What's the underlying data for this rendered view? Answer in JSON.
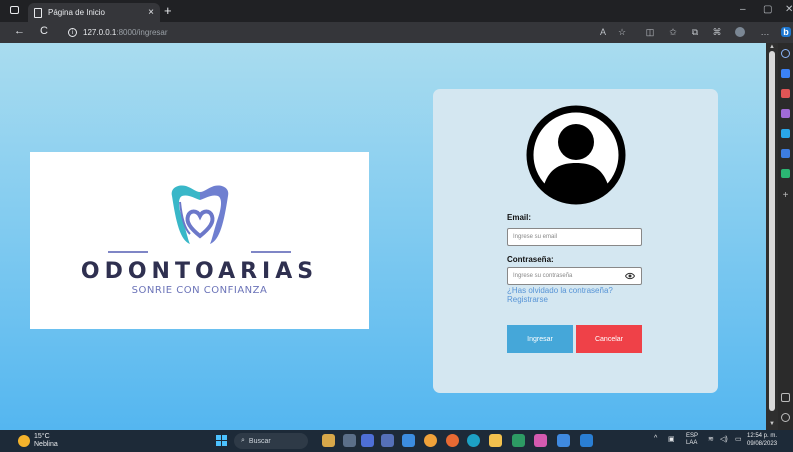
{
  "browser": {
    "tab_title": "Página de Inicio",
    "tab_close": "×",
    "new_tab": "+",
    "url_host": "127.0.0.1",
    "url_path": ":8000/ingresar",
    "window_controls": {
      "minimize": "–",
      "restore": "▢",
      "close": "✕"
    },
    "nav": {
      "back": "←",
      "reload": "C"
    }
  },
  "logo": {
    "name": "ODONTOARIAS",
    "tagline": "SONRIE CON CONFIANZA",
    "colors": {
      "tooth_left": "#39b7c8",
      "tooth_right": "#6f7fd0",
      "heart": "#6c78c9",
      "text": "#2f3050"
    }
  },
  "login": {
    "email_label": "Email:",
    "email_placeholder": "Ingrese su email",
    "password_label": "Contraseña:",
    "password_placeholder": "Ingrese su contraseña",
    "forgot_link": "¿Has olvidado la contraseña?",
    "register_link": "Registrarse",
    "submit_label": "Ingresar",
    "cancel_label": "Cancelar",
    "colors": {
      "submit": "#45a7d9",
      "cancel": "#ef4148"
    }
  },
  "taskbar": {
    "temperature": "15°C",
    "weather": "Neblina",
    "search": "Buscar",
    "lang_line1": "ESP",
    "lang_line2": "LAA",
    "time": "12:54 p. m.",
    "date": "09/08/2023"
  }
}
